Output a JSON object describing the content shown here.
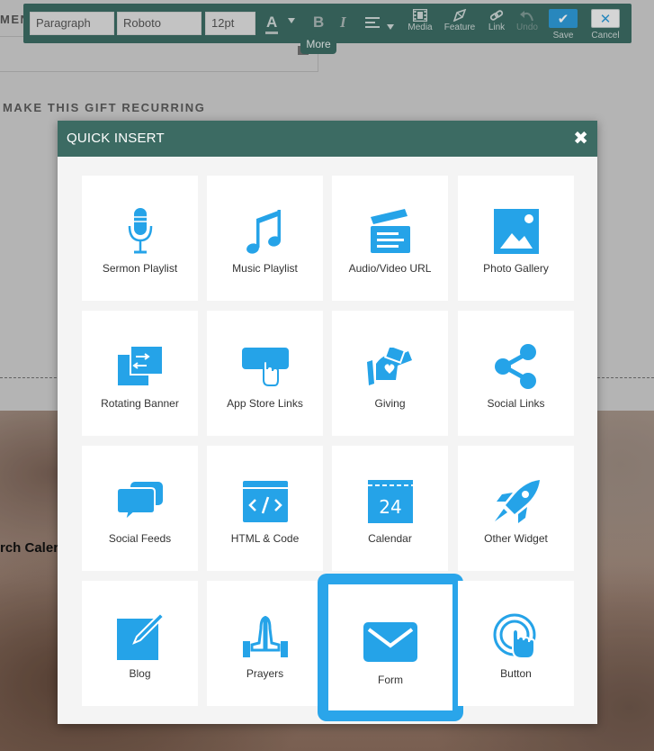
{
  "toolbar": {
    "format": "Paragraph",
    "font": "Roboto",
    "size": "12pt",
    "fontcolor_glyph": "A",
    "bold_glyph": "B",
    "italic_glyph": "I",
    "media": "Media",
    "feature": "Feature",
    "link": "Link",
    "undo": "Undo",
    "save": "Save",
    "cancel": "Cancel",
    "save_glyph": "✔",
    "cancel_glyph": "✕",
    "more_tooltip": "More"
  },
  "background": {
    "partial_heading": "MEN",
    "recurring_label": "MAKE THIS GIFT RECURRING",
    "calendar_partial": "rch Caler"
  },
  "modal": {
    "title": "QUICK INSERT",
    "close_glyph": "✖",
    "items": [
      {
        "label": "Sermon Playlist",
        "icon": "microphone-icon"
      },
      {
        "label": "Music Playlist",
        "icon": "music-note-icon"
      },
      {
        "label": "Audio/Video URL",
        "icon": "clapperboard-icon"
      },
      {
        "label": "Photo Gallery",
        "icon": "image-icon"
      },
      {
        "label": "Rotating Banner",
        "icon": "rotating-banner-icon"
      },
      {
        "label": "App Store Links",
        "icon": "app-store-icon"
      },
      {
        "label": "Giving",
        "icon": "giving-icon"
      },
      {
        "label": "Social Links",
        "icon": "share-icon"
      },
      {
        "label": "Social Feeds",
        "icon": "chat-bubbles-icon"
      },
      {
        "label": "HTML & Code",
        "icon": "code-icon"
      },
      {
        "label": "Calendar",
        "icon": "calendar-icon",
        "day": "24"
      },
      {
        "label": "Other Widget",
        "icon": "rocket-icon"
      },
      {
        "label": "Blog",
        "icon": "edit-icon"
      },
      {
        "label": "Prayers",
        "icon": "praying-hands-icon"
      },
      {
        "label": "Form",
        "icon": "envelope-icon",
        "selected": true
      },
      {
        "label": "Button",
        "icon": "tap-button-icon"
      }
    ]
  },
  "colors": {
    "toolbar_bg": "#3c6b63",
    "accent": "#2e9ad8",
    "icon": "#25a3e8",
    "selection": "#2aa5ea"
  }
}
